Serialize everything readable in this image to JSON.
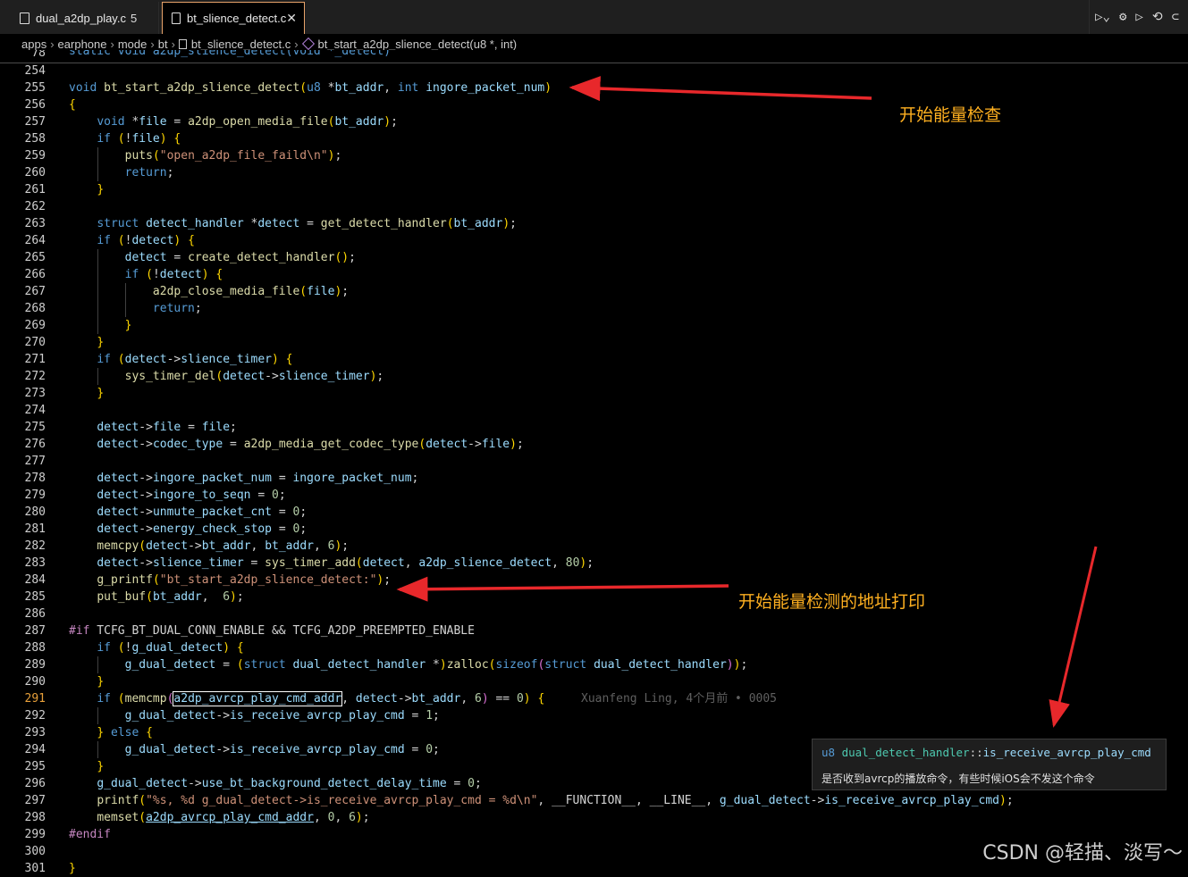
{
  "tabs": [
    {
      "label": "dual_a2dp_play.c",
      "count": "5"
    },
    {
      "label": "bt_slience_detect.c",
      "close": "✕"
    }
  ],
  "breadcrumb": [
    "apps",
    "earphone",
    "mode",
    "bt",
    "bt_slience_detect.c",
    "bt_start_a2dp_slience_detect(u8 *, int)"
  ],
  "sticky": {
    "ln": "78",
    "text": "static void a2dp_slience_detect(void *_detect)"
  },
  "lines": [
    {
      "n": "254",
      "t": ""
    },
    {
      "n": "255",
      "t": "void bt_start_a2dp_slience_detect(u8 *bt_addr, int ingore_packet_num)"
    },
    {
      "n": "256",
      "t": "{"
    },
    {
      "n": "257",
      "t": "    void *file = a2dp_open_media_file(bt_addr);"
    },
    {
      "n": "258",
      "t": "    if (!file) {"
    },
    {
      "n": "259",
      "t": "        puts(\"open_a2dp_file_faild\\n\");"
    },
    {
      "n": "260",
      "t": "        return;"
    },
    {
      "n": "261",
      "t": "    }"
    },
    {
      "n": "262",
      "t": ""
    },
    {
      "n": "263",
      "t": "    struct detect_handler *detect = get_detect_handler(bt_addr);"
    },
    {
      "n": "264",
      "t": "    if (!detect) {"
    },
    {
      "n": "265",
      "t": "        detect = create_detect_handler();"
    },
    {
      "n": "266",
      "t": "        if (!detect) {"
    },
    {
      "n": "267",
      "t": "            a2dp_close_media_file(file);"
    },
    {
      "n": "268",
      "t": "            return;"
    },
    {
      "n": "269",
      "t": "        }"
    },
    {
      "n": "270",
      "t": "    }"
    },
    {
      "n": "271",
      "t": "    if (detect->slience_timer) {"
    },
    {
      "n": "272",
      "t": "        sys_timer_del(detect->slience_timer);"
    },
    {
      "n": "273",
      "t": "    }"
    },
    {
      "n": "274",
      "t": ""
    },
    {
      "n": "275",
      "t": "    detect->file = file;"
    },
    {
      "n": "276",
      "t": "    detect->codec_type = a2dp_media_get_codec_type(detect->file);"
    },
    {
      "n": "277",
      "t": ""
    },
    {
      "n": "278",
      "t": "    detect->ingore_packet_num = ingore_packet_num;"
    },
    {
      "n": "279",
      "t": "    detect->ingore_to_seqn = 0;"
    },
    {
      "n": "280",
      "t": "    detect->unmute_packet_cnt = 0;"
    },
    {
      "n": "281",
      "t": "    detect->energy_check_stop = 0;"
    },
    {
      "n": "282",
      "t": "    memcpy(detect->bt_addr, bt_addr, 6);"
    },
    {
      "n": "283",
      "t": "    detect->slience_timer = sys_timer_add(detect, a2dp_slience_detect, 80);"
    },
    {
      "n": "284",
      "t": "    g_printf(\"bt_start_a2dp_slience_detect:\");"
    },
    {
      "n": "285",
      "t": "    put_buf(bt_addr,  6);"
    },
    {
      "n": "286",
      "t": ""
    },
    {
      "n": "287",
      "t": "#if TCFG_BT_DUAL_CONN_ENABLE && TCFG_A2DP_PREEMPTED_ENABLE"
    },
    {
      "n": "288",
      "t": "    if (!g_dual_detect) {"
    },
    {
      "n": "289",
      "t": "        g_dual_detect = (struct dual_detect_handler *)zalloc(sizeof(struct dual_detect_handler));"
    },
    {
      "n": "290",
      "t": "    }"
    },
    {
      "n": "291",
      "t": "    if (memcmp(a2dp_avrcp_play_cmd_addr, detect->bt_addr, 6) == 0) {"
    },
    {
      "n": "292",
      "t": "        g_dual_detect->is_receive_avrcp_play_cmd = 1;"
    },
    {
      "n": "293",
      "t": "    } else {"
    },
    {
      "n": "294",
      "t": "        g_dual_detect->is_receive_avrcp_play_cmd = 0;"
    },
    {
      "n": "295",
      "t": "    }"
    },
    {
      "n": "296",
      "t": "    g_dual_detect->use_bt_background_detect_delay_time = 0;"
    },
    {
      "n": "297",
      "t": "    printf(\"%s, %d g_dual_detect->is_receive_avrcp_play_cmd = %d\\n\", __FUNCTION__, __LINE__, g_dual_detect->is_receive_avrcp_play_cmd);"
    },
    {
      "n": "298",
      "t": "    memset(a2dp_avrcp_play_cmd_addr, 0, 6);"
    },
    {
      "n": "299",
      "t": "#endif"
    },
    {
      "n": "300",
      "t": ""
    },
    {
      "n": "301",
      "t": "}"
    }
  ],
  "current_line": "291",
  "blame": "Xuanfeng Ling, 4个月前 • 0005",
  "annotations": [
    {
      "text": "开始能量检查"
    },
    {
      "text": "开始能量检测的地址打印"
    }
  ],
  "tooltip": {
    "signature": "u8 dual_detect_handler::is_receive_avrcp_play_cmd",
    "doc": "是否收到avrcp的播放命令，有些时候iOS会不发这个命令"
  },
  "watermark": "CSDN @轻描、淡写～",
  "colors": {
    "keyword": "#569cd6",
    "function": "#dcdcaa",
    "variable": "#9cdcfe",
    "string": "#ce9178",
    "number": "#b5cea8",
    "annotation": "#ffb020",
    "arrow": "#e8282b"
  }
}
